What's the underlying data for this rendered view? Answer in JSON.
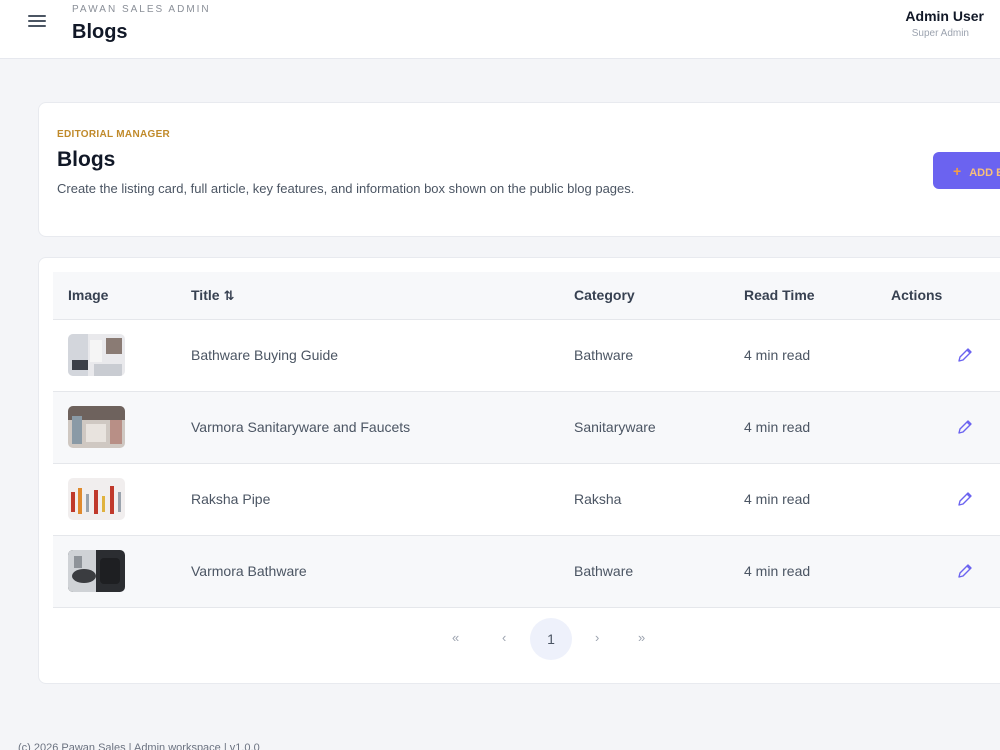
{
  "topbar": {
    "kicker": "PAWAN SALES ADMIN",
    "title": "Blogs",
    "user_name": "Admin User",
    "user_role": "Super Admin"
  },
  "header": {
    "kicker": "EDITORIAL MANAGER",
    "title": "Blogs",
    "description": "Create the listing card, full article, key features, and information box shown on the public blog pages.",
    "add_button_label": "ADD BLOG",
    "accent_color": "#6b63f0",
    "kicker_color": "#c08a2a"
  },
  "table": {
    "columns": [
      "Image",
      "Title",
      "Category",
      "Read Time",
      "Actions"
    ],
    "sort_icon": "⇅",
    "rows": [
      {
        "title": "Bathware Buying Guide",
        "category": "Bathware",
        "read_time": "4 min read",
        "thumb": "bathroom-photo"
      },
      {
        "title": "Varmora Sanitaryware and Faucets",
        "category": "Sanitaryware",
        "read_time": "4 min read",
        "thumb": "sanitaryware-photo"
      },
      {
        "title": "Raksha Pipe",
        "category": "Raksha",
        "read_time": "4 min read",
        "thumb": "pipes-photo"
      },
      {
        "title": "Varmora Bathware",
        "category": "Bathware",
        "read_time": "4 min read",
        "thumb": "washbasin-photo"
      }
    ]
  },
  "pagination": {
    "first": "«",
    "prev": "‹",
    "current": "1",
    "next": "›",
    "last": "»"
  },
  "footer": {
    "text": "(c) 2026 Pawan Sales | Admin workspace | v1.0.0"
  }
}
